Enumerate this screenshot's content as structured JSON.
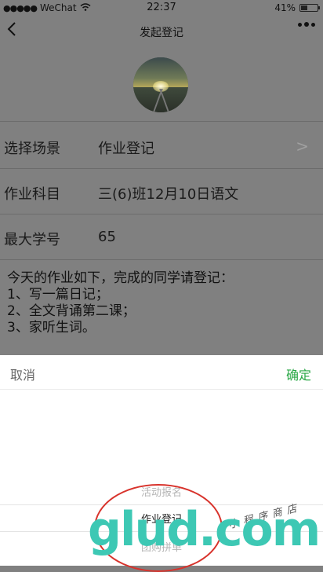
{
  "status_bar": {
    "carrier": "WeChat",
    "time": "22:37",
    "battery_text": "41%",
    "battery_level": 0.41
  },
  "nav": {
    "title": "发起登记"
  },
  "form": {
    "rows": [
      {
        "label": "选择场景",
        "value": "作业登记",
        "chevron": ">"
      },
      {
        "label": "作业科目",
        "value": "三(6)班12月10日语文"
      },
      {
        "label": "最大学号",
        "value": "65"
      }
    ],
    "description": "今天的作业如下，完成的同学请登记：\n1、写一篇日记；\n2、全文背诵第二课；\n3、家听生词。"
  },
  "sheet": {
    "cancel_label": "取消",
    "confirm_label": "确定",
    "confirm_color": "#28a745",
    "options": [
      "活动报名",
      "作业登记",
      "团购拼单"
    ],
    "selected_index": 1
  },
  "watermark": {
    "logo_text": "glud.com",
    "tag_text": "小程序商店"
  }
}
